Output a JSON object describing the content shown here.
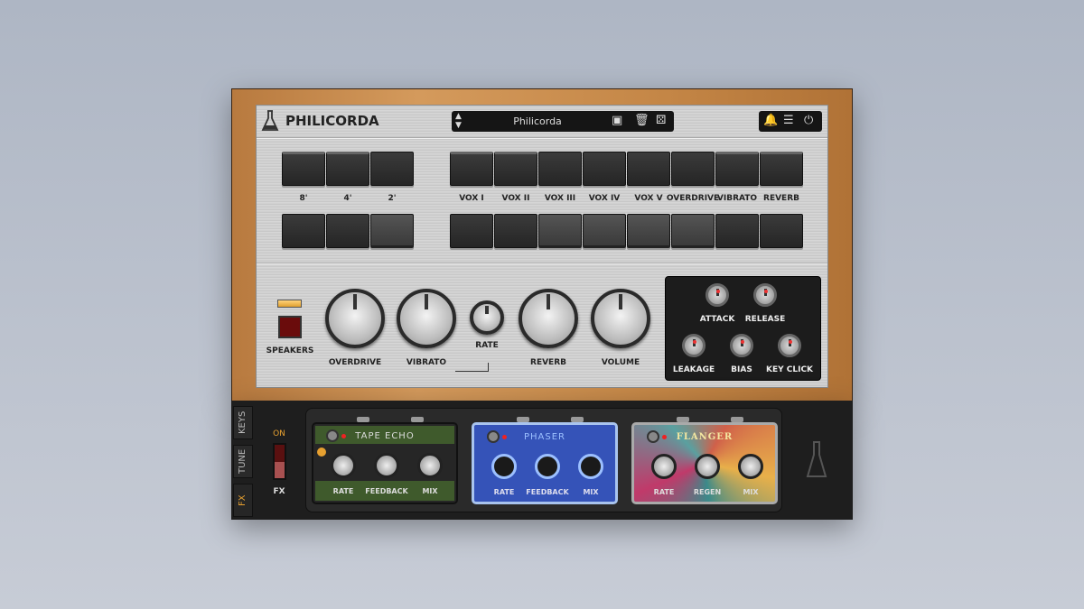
{
  "header": {
    "title": "PHILICORDA",
    "preset": "Philicorda",
    "icons": [
      "flask-logo-icon",
      "up-down-arrows-icon",
      "save-icon",
      "trash-icon",
      "dice-icon",
      "bell-icon",
      "menu-icon",
      "power-icon"
    ]
  },
  "footage": {
    "labels": [
      "8'",
      "4'",
      "2'"
    ],
    "top_active": [
      true,
      true,
      false
    ],
    "bottom_active": [
      false,
      false,
      true
    ]
  },
  "voices": {
    "labels": [
      "VOX I",
      "VOX II",
      "VOX III",
      "VOX IV",
      "VOX V",
      "OVERDRIVE",
      "VIBRATO",
      "REVERB"
    ],
    "top_active": [
      true,
      true,
      false,
      false,
      false,
      false,
      true,
      true
    ],
    "bottom_active": [
      false,
      false,
      true,
      true,
      true,
      true,
      false,
      false
    ]
  },
  "controls": {
    "speakers": "SPEAKERS",
    "knobs": [
      "OVERDRIVE",
      "VIBRATO",
      "RATE",
      "REVERB",
      "VOLUME"
    ]
  },
  "envelope": {
    "knobs": [
      "ATTACK",
      "RELEASE",
      "LEAKAGE",
      "BIAS",
      "KEY CLICK"
    ]
  },
  "side_tabs": [
    "KEYS",
    "TUNE",
    "FX"
  ],
  "fx_switch": {
    "on": "ON",
    "label": "FX"
  },
  "pedals": [
    {
      "name": "TAPE ECHO",
      "knobs": [
        "RATE",
        "FEEDBACK",
        "MIX"
      ],
      "color": "#3f5a2c"
    },
    {
      "name": "PHASER",
      "knobs": [
        "RATE",
        "FEEDBACK",
        "MIX"
      ],
      "color": "#3553b8"
    },
    {
      "name": "FLANGER",
      "knobs": [
        "RATE",
        "REGEN",
        "MIX"
      ],
      "color": "#c65a4a"
    }
  ],
  "colors": {
    "wood": "#c48646",
    "led": "#f2b446",
    "active_tab": "#e6a030"
  }
}
